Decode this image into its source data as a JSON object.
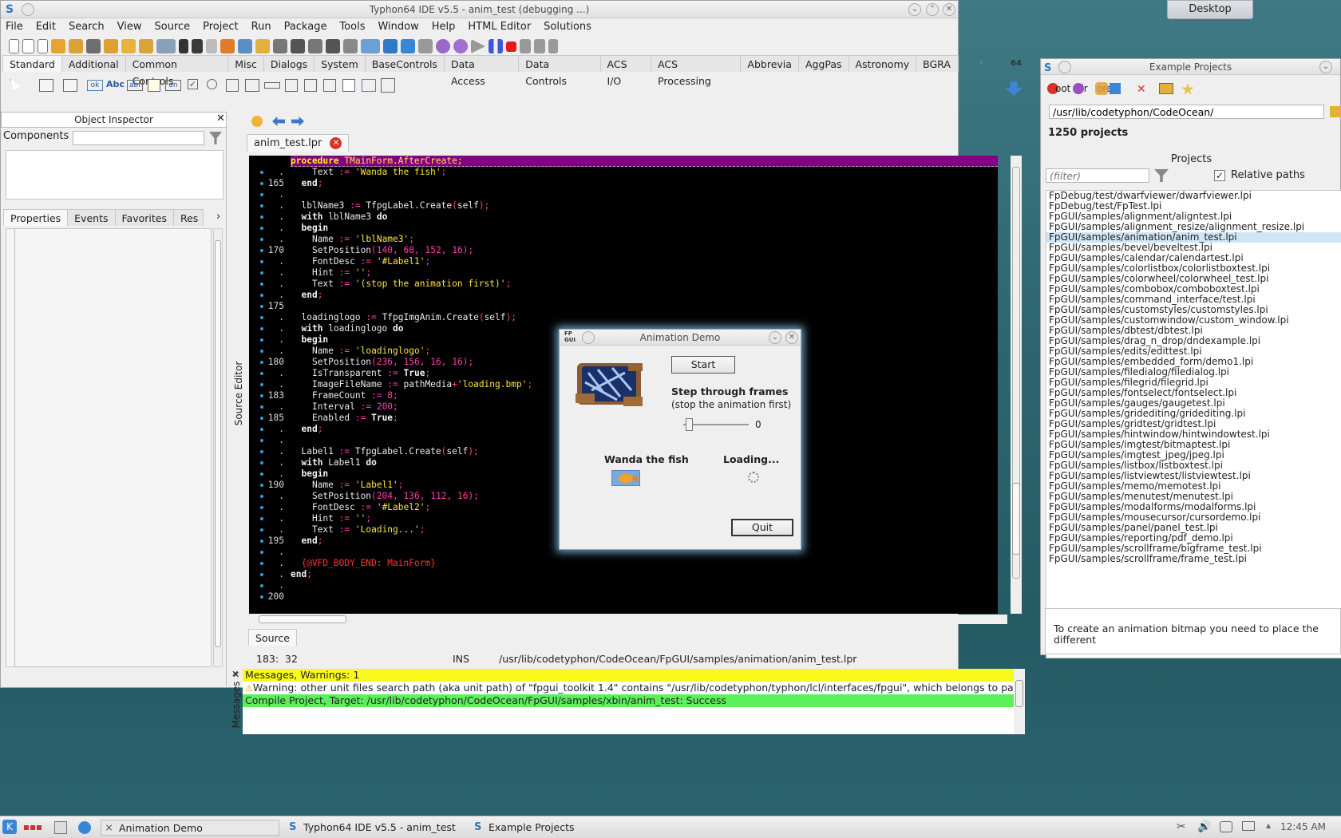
{
  "ide": {
    "title": "Typhon64 IDE v5.5 - anim_test (debugging ...)",
    "menu": [
      "File",
      "Edit",
      "Search",
      "View",
      "Source",
      "Project",
      "Run",
      "Package",
      "Tools",
      "Window",
      "Help",
      "HTML Editor",
      "Solutions"
    ],
    "palette_tabs": [
      "Standard",
      "Additional",
      "Common Controls",
      "Misc",
      "Dialogs",
      "System",
      "BaseControls",
      "Data Access",
      "Data Controls",
      "ACS I/O",
      "ACS Processing",
      "Abbrevia",
      "AggPas",
      "Astronomy",
      "BGRA Cc"
    ],
    "badge": "64",
    "palette_items": [
      "ok",
      "Abc",
      "abI",
      "on"
    ]
  },
  "object_inspector": {
    "title": "Object Inspector",
    "components_label": "Components",
    "tabs": [
      "Properties",
      "Events",
      "Favorites",
      "Res"
    ]
  },
  "editor": {
    "file_tab": "anim_test.lpr",
    "side_label": "Source Editor",
    "source_tab": "Source",
    "status": {
      "pos": "183:  32",
      "mode": "INS",
      "path": "/usr/lib/codetyphon/CodeOcean/FpGUI/samples/animation/anim_test.lpr"
    },
    "gutter": [
      "",
      ".",
      "165",
      ".",
      ".",
      ".",
      ".",
      ".",
      "170",
      ".",
      ".",
      ".",
      ".",
      "175",
      ".",
      ".",
      ".",
      ".",
      "180",
      ".",
      ".",
      "183",
      ".",
      "185",
      ".",
      ".",
      ".",
      ".",
      ".",
      "190",
      ".",
      ".",
      ".",
      ".",
      "195",
      ".",
      ".",
      ".",
      ".",
      "200"
    ],
    "code": [
      "procedure TMainForm.AfterCreate;",
      "    Text := 'Wanda the fish';",
      "  end;",
      "",
      "  lblName3 := TfpgLabel.Create(self);",
      "  with lblName3 do",
      "  begin",
      "    Name := 'lblName3';",
      "    SetPosition(140, 68, 152, 16);",
      "    FontDesc := '#Label1';",
      "    Hint := '';",
      "    Text := '(stop the animation first)';",
      "  end;",
      "",
      "  loadinglogo := TfpgImgAnim.Create(self);",
      "  with loadinglogo do",
      "  begin",
      "    Name := 'loadinglogo';",
      "    SetPosition(236, 156, 16, 16);",
      "    IsTransparent := True;",
      "    ImageFileName := pathMedia+'loading.bmp';",
      "    FrameCount := 8;",
      "    Interval := 200;",
      "    Enabled := True;",
      "  end;",
      "",
      "  Label1 := TfpgLabel.Create(self);",
      "  with Label1 do",
      "  begin",
      "    Name := 'Label1';",
      "    SetPosition(204, 136, 112, 16);",
      "    FontDesc := '#Label2';",
      "    Hint := '';",
      "    Text := 'Loading...';",
      "  end;",
      "",
      "  {@VFD_BODY_END: MainForm}",
      "end;"
    ]
  },
  "messages": {
    "side_label": "Messages",
    "header": "Messages, Warnings: 1",
    "warning": "Warning: other unit files search path (aka unit path) of \"fpgui_toolkit 1.4\" contains \"/usr/lib/codetyphon/typhon/lcl/interfaces/fpgui\", which belongs to pa",
    "success": "Compile Project, Target: /usr/lib/codetyphon/CodeOcean/FpGUI/samples/xbin/anim_test: Success"
  },
  "demo": {
    "title": "Animation Demo",
    "logo_text": "FP GUI",
    "start": "Start",
    "step_label": "Step through frames",
    "step_sub": "(stop the animation first)",
    "slider_value": "0",
    "wanda": "Wanda the fish",
    "loading": "Loading...",
    "quit": "Quit"
  },
  "examples": {
    "title": "Example Projects",
    "toolbar_text": "oot Dir",
    "toolbar_text2": "ore",
    "path": "/usr/lib/codetyphon/CodeOcean/",
    "count": "1250 projects",
    "projects_label": "Projects",
    "filter_placeholder": "(filter)",
    "relative_paths": "Relative paths",
    "items": [
      "FpDebug/test/dwarfviewer/dwarfviewer.lpi",
      "FpDebug/test/FpTest.lpi",
      "FpGUI/samples/alignment/aligntest.lpi",
      "FpGUI/samples/alignment_resize/alignment_resize.lpi",
      "FpGUI/samples/animation/anim_test.lpi",
      "FpGUI/samples/bevel/beveltest.lpi",
      "FpGUI/samples/calendar/calendartest.lpi",
      "FpGUI/samples/colorlistbox/colorlistboxtest.lpi",
      "FpGUI/samples/colorwheel/colorwheel_test.lpi",
      "FpGUI/samples/combobox/comboboxtest.lpi",
      "FpGUI/samples/command_interface/test.lpi",
      "FpGUI/samples/customstyles/customstyles.lpi",
      "FpGUI/samples/customwindow/custom_window.lpi",
      "FpGUI/samples/dbtest/dbtest.lpi",
      "FpGUI/samples/drag_n_drop/dndexample.lpi",
      "FpGUI/samples/edits/edittest.lpi",
      "FpGUI/samples/embedded_form/demo1.lpi",
      "FpGUI/samples/filedialog/filedialog.lpi",
      "FpGUI/samples/filegrid/filegrid.lpi",
      "FpGUI/samples/fontselect/fontselect.lpi",
      "FpGUI/samples/gauges/gaugetest.lpi",
      "FpGUI/samples/gridediting/gridediting.lpi",
      "FpGUI/samples/gridtest/gridtest.lpi",
      "FpGUI/samples/hintwindow/hintwindowtest.lpi",
      "FpGUI/samples/imgtest/bitmaptest.lpi",
      "FpGUI/samples/imgtest_jpeg/jpeg.lpi",
      "FpGUI/samples/listbox/listboxtest.lpi",
      "FpGUI/samples/listviewtest/listviewtest.lpi",
      "FpGUI/samples/memo/memotest.lpi",
      "FpGUI/samples/menutest/menutest.lpi",
      "FpGUI/samples/modalforms/modalforms.lpi",
      "FpGUI/samples/mousecursor/cursordemo.lpi",
      "FpGUI/samples/panel/panel_test.lpi",
      "FpGUI/samples/reporting/pdf_demo.lpi",
      "FpGUI/samples/scrollframe/bigframe_test.lpi",
      "FpGUI/samples/scrollframe/frame_test.lpi"
    ],
    "description": "To create an animation bitmap you need to place the different"
  },
  "desktop_button": "Desktop",
  "taskbar": {
    "tasks": [
      "Animation Demo",
      "Typhon64 IDE v5.5 - anim_test (",
      "Example Projects"
    ],
    "clock": "12:45 AM"
  }
}
